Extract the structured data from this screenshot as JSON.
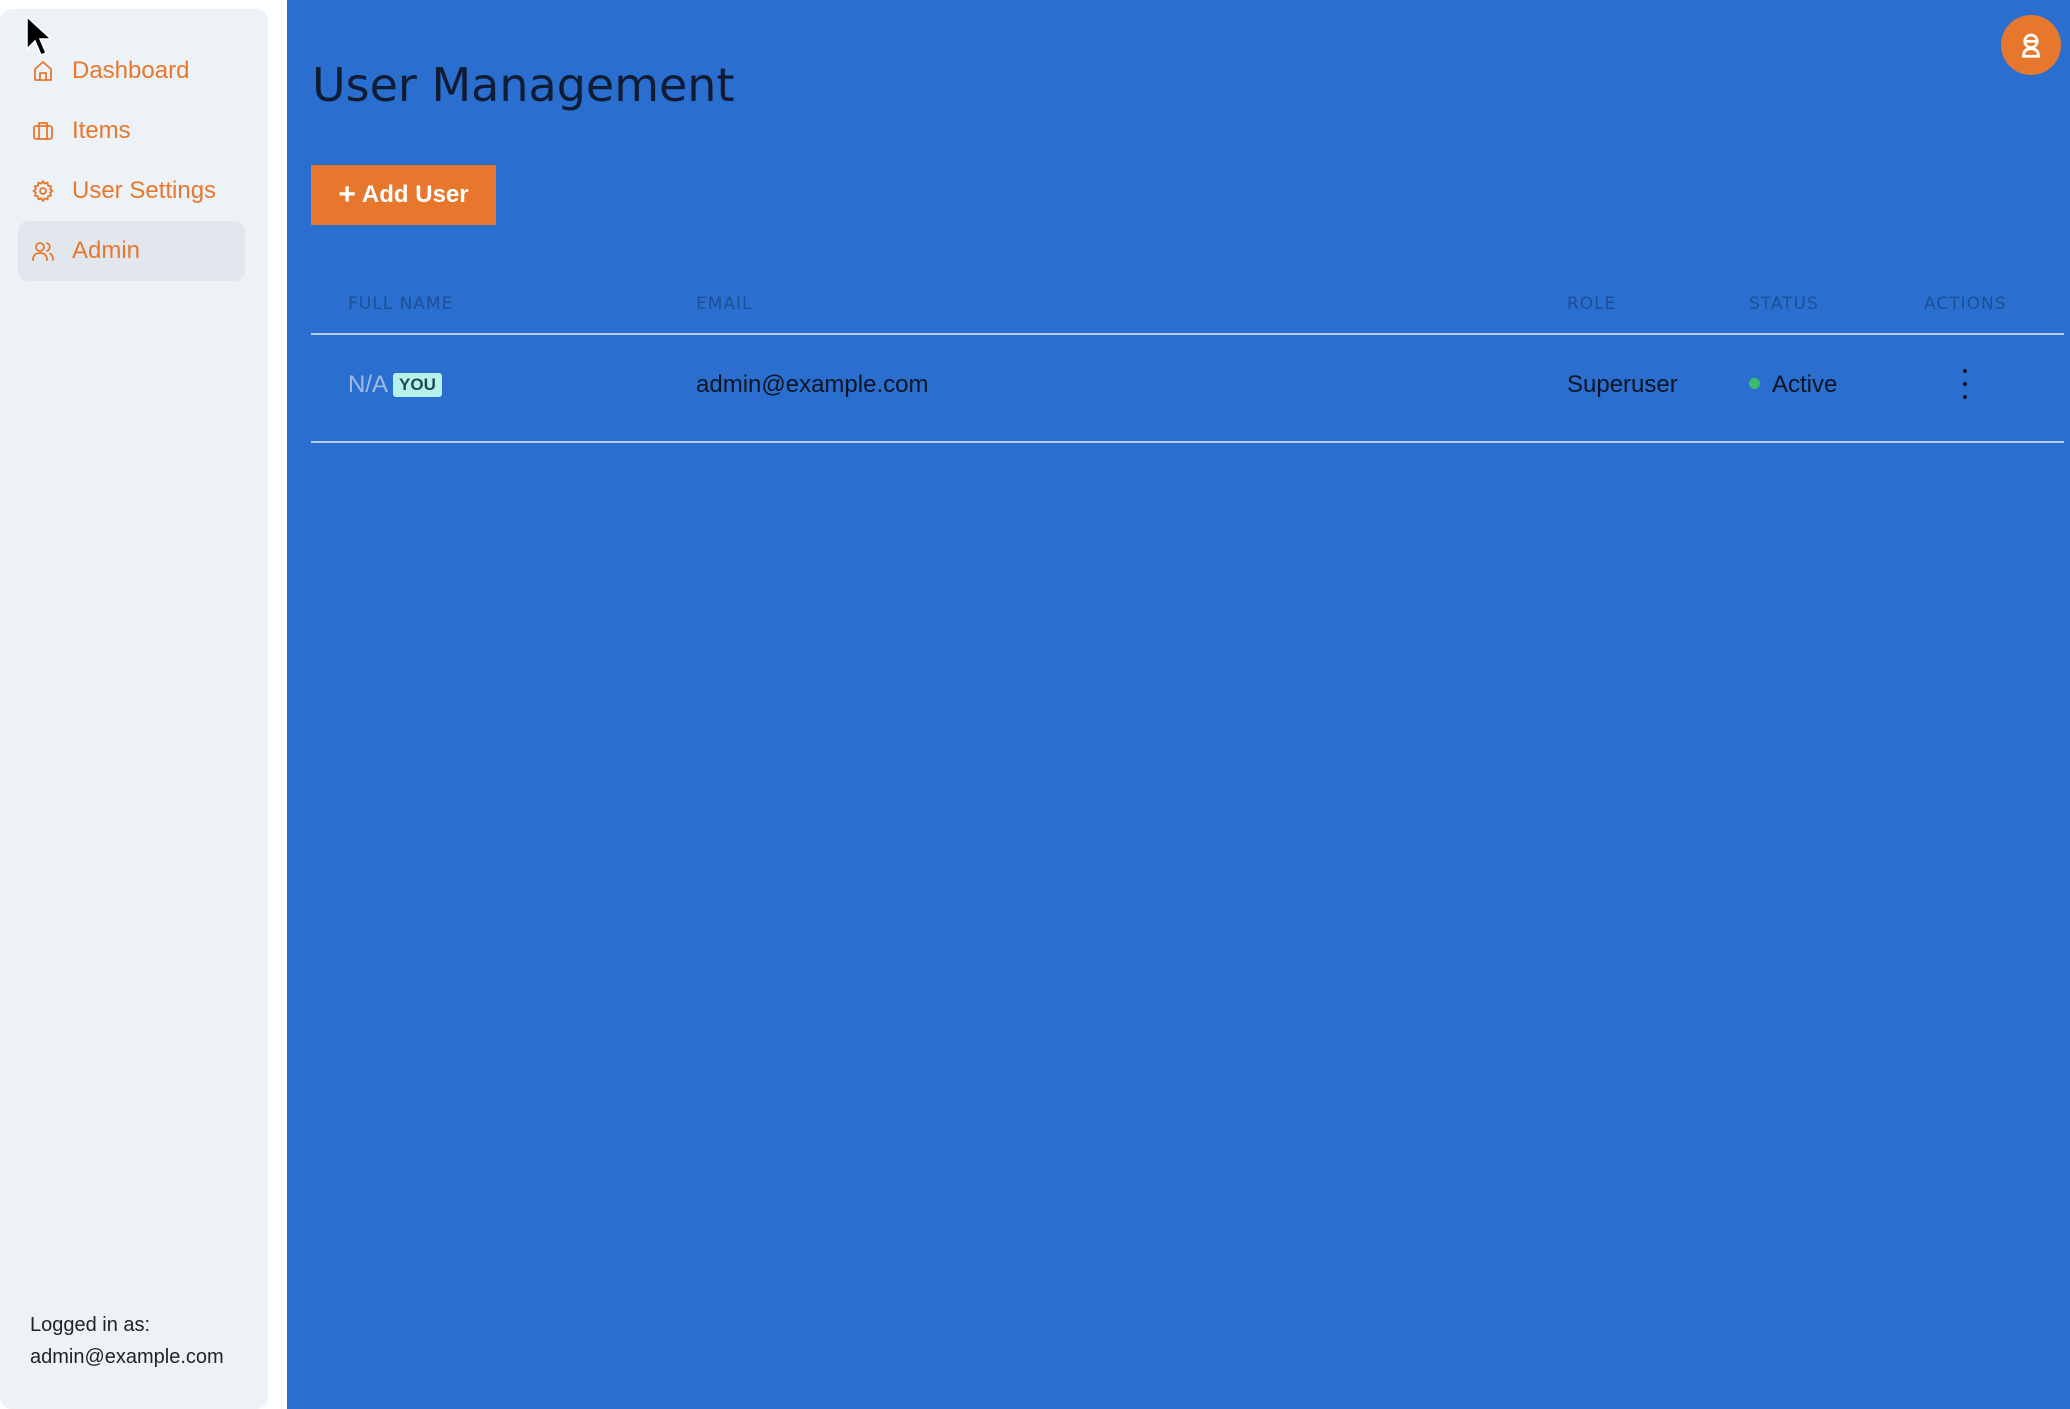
{
  "sidebar": {
    "items": [
      {
        "label": "Dashboard",
        "icon": "home-icon",
        "active": false
      },
      {
        "label": "Items",
        "icon": "briefcase-icon",
        "active": false
      },
      {
        "label": "User Settings",
        "icon": "gear-icon",
        "active": false
      },
      {
        "label": "Admin",
        "icon": "users-icon",
        "active": true
      }
    ],
    "footer": {
      "logged_in_label": "Logged in as:",
      "email": "admin@example.com"
    }
  },
  "main": {
    "title": "User Management",
    "add_button_label": "Add User",
    "add_button_icon": "+",
    "avatar_icon": "user-avatar-icon",
    "table": {
      "columns": [
        "FULL NAME",
        "EMAIL",
        "ROLE",
        "STATUS",
        "ACTIONS"
      ],
      "rows": [
        {
          "full_name": "N/A",
          "badge": "YOU",
          "email": "admin@example.com",
          "role": "Superuser",
          "status": "Active",
          "actions_icon": "kebab-menu-icon"
        }
      ]
    }
  },
  "colors": {
    "accent": "#e8772e",
    "main_bg": "#2a6fcf",
    "sidebar_bg": "#edf2f6",
    "status_active": "#3dbb6c",
    "badge_bg": "#b6f1ea"
  }
}
